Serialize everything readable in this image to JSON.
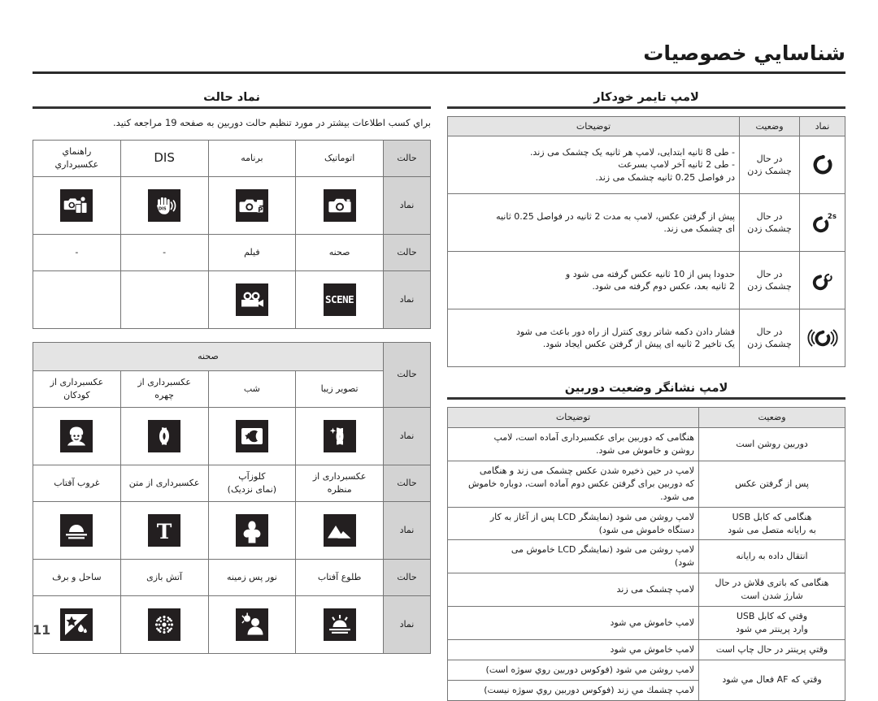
{
  "page": {
    "title": "شناسايي خصوصيات",
    "number": "11"
  },
  "right_column": {
    "section1": {
      "heading": "لامپ تايمر خودكار",
      "headers": {
        "symbol": "نماد",
        "status": "وضعیت",
        "description": "توضیحات"
      },
      "rows": [
        {
          "symbol_icon": "self-timer-10s-icon",
          "status": "در حال\nچشمک زدن",
          "status_line1": "در حال",
          "status_line2": "چشمک زدن",
          "description": "- طی 8 ثانیه ابتدایی، لامپ هر ثانیه یک چشمک می زند.\n- طی 2 ثانیه آخر لامپ بسرعت\n  در فواصل 0.25 ثانیه چشمک می زند.",
          "desc_lines": [
            "- طی 8 ثانیه ابتدایی، لامپ هر ثانیه یک چشمک می زند.",
            "- طی 2 ثانیه آخر لامپ بسرعت",
            "در فواصل 0.25 ثانیه چشمک می زند."
          ]
        },
        {
          "symbol_icon": "self-timer-2s-icon",
          "status_line1": "در حال",
          "status_line2": "چشمک زدن",
          "desc_lines": [
            "پیش از گرفتن عکس، لامپ به مدت 2 ثانیه در فواصل 0.25 ثانیه",
            "ای چشمک می زند."
          ]
        },
        {
          "symbol_icon": "self-timer-double-icon",
          "status_line1": "در حال",
          "status_line2": "چشمک زدن",
          "desc_lines": [
            "حدودا پس از 10 ثانیه عکس گرفته می شود و",
            "2 ثانیه بعد، عکس دوم گرفته می شود."
          ]
        },
        {
          "symbol_icon": "self-timer-remote-icon",
          "status_line1": "در حال",
          "status_line2": "چشمک زدن",
          "desc_lines": [
            "فشار دادن دکمه شاتر روی کنترل از راه دور باعث می شود",
            "یک تاخیر 2 ثانیه ای پیش از گرفتن عکس ایجاد شود."
          ]
        }
      ]
    },
    "section2": {
      "heading": "لامپ نشانگر وضعیت دوربین",
      "headers": {
        "status": "وضعیت",
        "description": "توضیحات"
      },
      "rows": [
        {
          "state_lines": [
            "دوربین روشن است"
          ],
          "desc_lines": [
            "هنگامی که دوربین برای عکسبرداری آماده است، لامپ",
            "روشن و خاموش می شود."
          ]
        },
        {
          "state_lines": [
            "پس از گرفتن عکس"
          ],
          "desc_lines": [
            "لامپ در حین ذخیره شدن عکس چشمک می زند و هنگامی",
            "که دوربین برای گرفتن عکس دوم آماده است، دوباره خاموش",
            "می شود."
          ]
        },
        {
          "state_lines": [
            "هنگامی که کابل USB",
            "به رایانه متصل می شود"
          ],
          "desc_lines": [
            "لامپ روشن می شود (نمایشگر LCD پس از آغاز به کار",
            "دستگاه خاموش می شود)"
          ]
        },
        {
          "state_lines": [
            "انتقال داده به رایانه"
          ],
          "desc_lines": [
            "لامپ روشن می شود (نمایشگر LCD خاموش می",
            "شود)"
          ]
        },
        {
          "state_lines": [
            "هنگامی که باتری فلاش در حال",
            "شارژ شدن است"
          ],
          "desc_lines": [
            "لامپ چشمک می زند"
          ]
        },
        {
          "state_lines": [
            "وقتي که کابل USB",
            "وارد پرینتر مي شود"
          ],
          "desc_lines": [
            "لامپ خاموش مي شود"
          ]
        },
        {
          "state_lines": [
            "وقتي پرینتر در حال چاپ است"
          ],
          "desc_lines": [
            "لامپ خاموش مي شود"
          ]
        },
        {
          "state_lines": [
            "وقتي که AF فعال مي شود"
          ],
          "desc_lines": [
            "لامپ روشن مي شود (فوکوس دوربین روي سوژه است)",
            "لامپ چشمك مي زند (فوکوس دوربین روي سوژه نیست)"
          ],
          "split": true
        }
      ]
    }
  },
  "left_column": {
    "section1": {
      "heading": "نماد حالت",
      "note": "براي كسب اطلاعات بیشتر در مورد تنظیم حالت دوربین به صفحه 19 مراجعه كنید.",
      "row_labels": {
        "mode": "حالت",
        "symbol": "نماد"
      },
      "group1": {
        "modes": [
          "اتوماتیک",
          "برنامه",
          "DIS",
          "راهنماي\nعکسبرداري"
        ],
        "mode_cells": [
          {
            "lines": [
              "اتوماتیک"
            ]
          },
          {
            "lines": [
              "برنامه"
            ]
          },
          {
            "lines": [
              "DIS"
            ],
            "ltr": true
          },
          {
            "lines": [
              "راهنماي",
              "عکسبرداري"
            ]
          }
        ],
        "icons": [
          "camera-auto-icon",
          "camera-program-icon",
          "hand-dis-icon",
          "photo-help-guide-icon"
        ]
      },
      "group2": {
        "mode_cells": [
          {
            "lines": [
              "صحنه"
            ]
          },
          {
            "lines": [
              "فیلم"
            ]
          },
          {
            "lines": [
              "-"
            ]
          },
          {
            "lines": [
              "-"
            ]
          }
        ],
        "icons": [
          "scene-word-icon",
          "movie-camera-icon",
          "",
          ""
        ]
      }
    },
    "section2": {
      "group_header": "صحنه",
      "row_labels": {
        "mode": "حالت",
        "symbol": "نماد"
      },
      "rows": [
        {
          "mode_cells": [
            {
              "lines": [
                "تصویر زیبا"
              ]
            },
            {
              "lines": [
                "شب"
              ]
            },
            {
              "lines": [
                "عکسبرداری از",
                "چهره"
              ]
            },
            {
              "lines": [
                "عکسبرداری از",
                "کودکان"
              ]
            }
          ],
          "icons": [
            "beauty-shot-icon",
            "night-icon",
            "portrait-icon",
            "children-icon"
          ]
        },
        {
          "mode_cells": [
            {
              "lines": [
                "عکسبرداری از",
                "منظره"
              ]
            },
            {
              "lines": [
                "کلوزآپ",
                "(نمای نزدیک)"
              ]
            },
            {
              "lines": [
                "عکسبرداری از متن"
              ]
            },
            {
              "lines": [
                "غروب آفتاب"
              ]
            }
          ],
          "icons": [
            "landscape-icon",
            "close-up-icon",
            "text-icon",
            "sunset-icon"
          ]
        },
        {
          "mode_cells": [
            {
              "lines": [
                "طلوع آفتاب"
              ]
            },
            {
              "lines": [
                "نور پس زمینه"
              ]
            },
            {
              "lines": [
                "آتش بازی"
              ]
            },
            {
              "lines": [
                "ساحل و برف"
              ]
            }
          ],
          "icons": [
            "sunrise-icon",
            "backlight-icon",
            "fireworks-icon",
            "beach-snow-icon"
          ]
        }
      ]
    }
  },
  "colors": {
    "header_bg": "#e4e4e4",
    "label_bg": "#d3d3d3",
    "border": "#757575",
    "tile_bg": "#231f20",
    "text": "#1b1b1b"
  }
}
